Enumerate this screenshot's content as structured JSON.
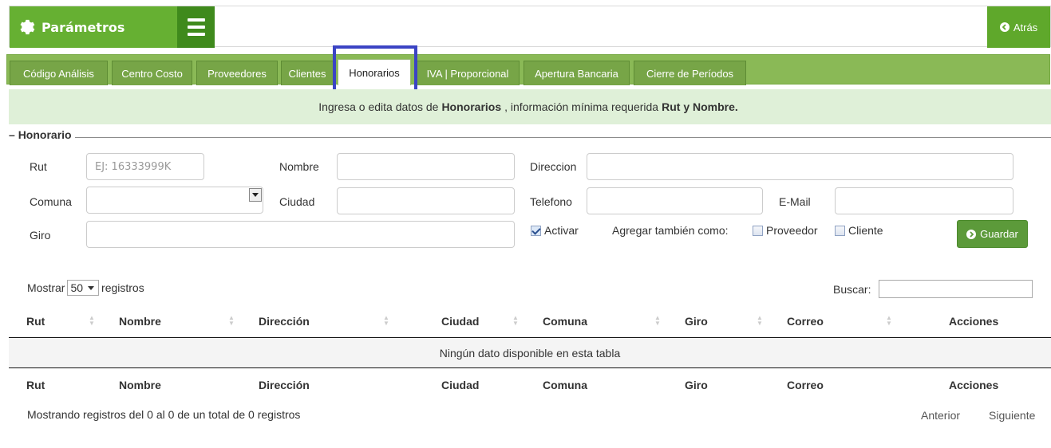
{
  "header": {
    "title": "Parámetros",
    "back_label": "Atrás"
  },
  "tabs": [
    {
      "label": "Código Análisis"
    },
    {
      "label": "Centro Costo"
    },
    {
      "label": "Proveedores"
    },
    {
      "label": "Clientes"
    },
    {
      "label": "Honorarios",
      "active": true
    },
    {
      "label": "IVA | Proporcional"
    },
    {
      "label": "Apertura Bancaria"
    },
    {
      "label": "Cierre de Períodos"
    }
  ],
  "info": {
    "prefix": "Ingresa o edita datos de",
    "entity": "Honorarios",
    "middle": ", información mínima requerida",
    "required": "Rut y Nombre."
  },
  "form": {
    "legend": "Honorario",
    "rut_label": "Rut",
    "rut_placeholder": "EJ: 16333999K",
    "nombre_label": "Nombre",
    "direccion_label": "Direccion",
    "comuna_label": "Comuna",
    "ciudad_label": "Ciudad",
    "telefono_label": "Telefono",
    "email_label": "E-Mail",
    "giro_label": "Giro",
    "activar_label": "Activar",
    "activar_checked": true,
    "also_label": "Agregar también como:",
    "proveedor_label": "Proveedor",
    "cliente_label": "Cliente",
    "save_label": "Guardar"
  },
  "table": {
    "show_label": "Mostrar",
    "page_size": "50",
    "records_label": "registros",
    "search_label": "Buscar:",
    "columns": [
      "Rut",
      "Nombre",
      "Dirección",
      "Ciudad",
      "Comuna",
      "Giro",
      "Correo",
      "Acciones"
    ],
    "empty_text": "Ningún dato disponible en esta tabla",
    "footer_info": "Mostrando registros del 0 al 0 de un total de 0 registros",
    "prev_label": "Anterior",
    "next_label": "Siguiente"
  },
  "colors": {
    "brand": "#66b032",
    "brand_dark": "#3f8a1c",
    "tabbar": "#8ab956",
    "info_bg": "#dff0d8",
    "highlight": "#3b44c4"
  }
}
